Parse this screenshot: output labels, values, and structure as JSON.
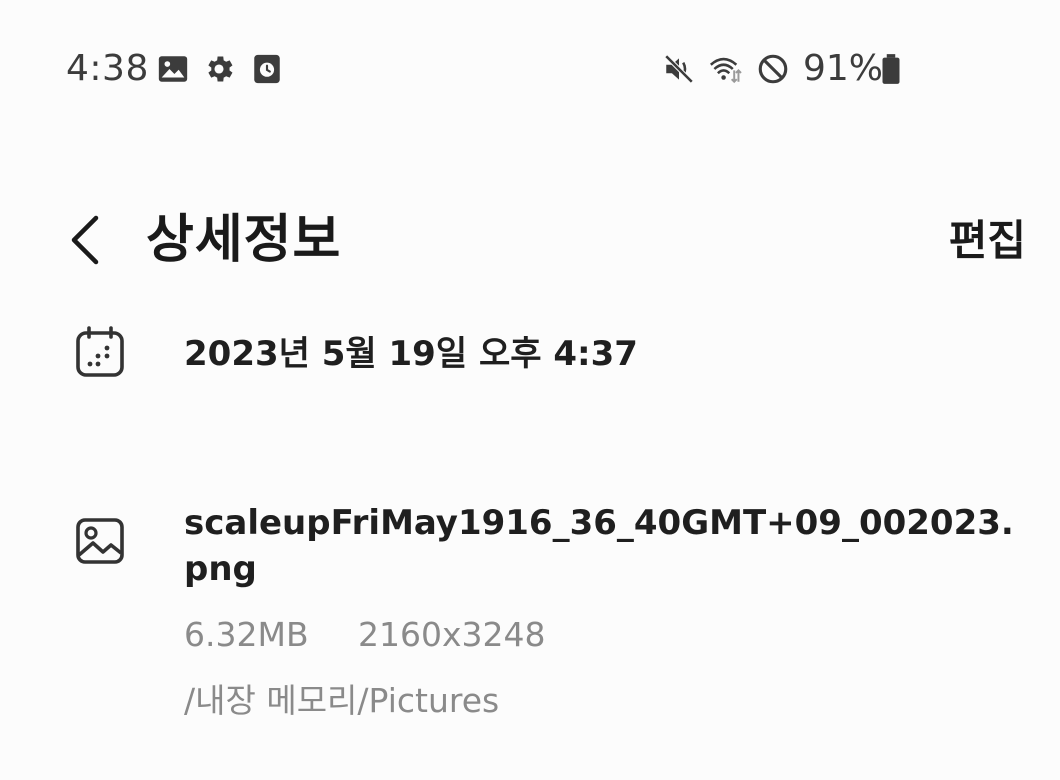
{
  "status_bar": {
    "time": "4:38",
    "left_icons": [
      "gallery-icon",
      "settings-icon",
      "screen-recorder-icon"
    ],
    "right_icons": [
      "mute-icon",
      "wifi-icon",
      "do-not-disturb-icon",
      "battery-icon"
    ],
    "battery_percent": "91%"
  },
  "header": {
    "title": "상세정보",
    "edit_label": "편집"
  },
  "details": {
    "date": "2023년 5월 19일 오후 4:37",
    "file_name": "scaleupFriMay1916_36_40GMT+09_002023.png",
    "file_size": "6.32MB",
    "resolution": "2160x3248",
    "path": "/내장 메모리/Pictures"
  },
  "colors": {
    "background": "#fcfcfc",
    "primary_text": "#1f1f1f",
    "secondary_text": "#8a8a8a",
    "status_icons": "#3c3c3c"
  }
}
